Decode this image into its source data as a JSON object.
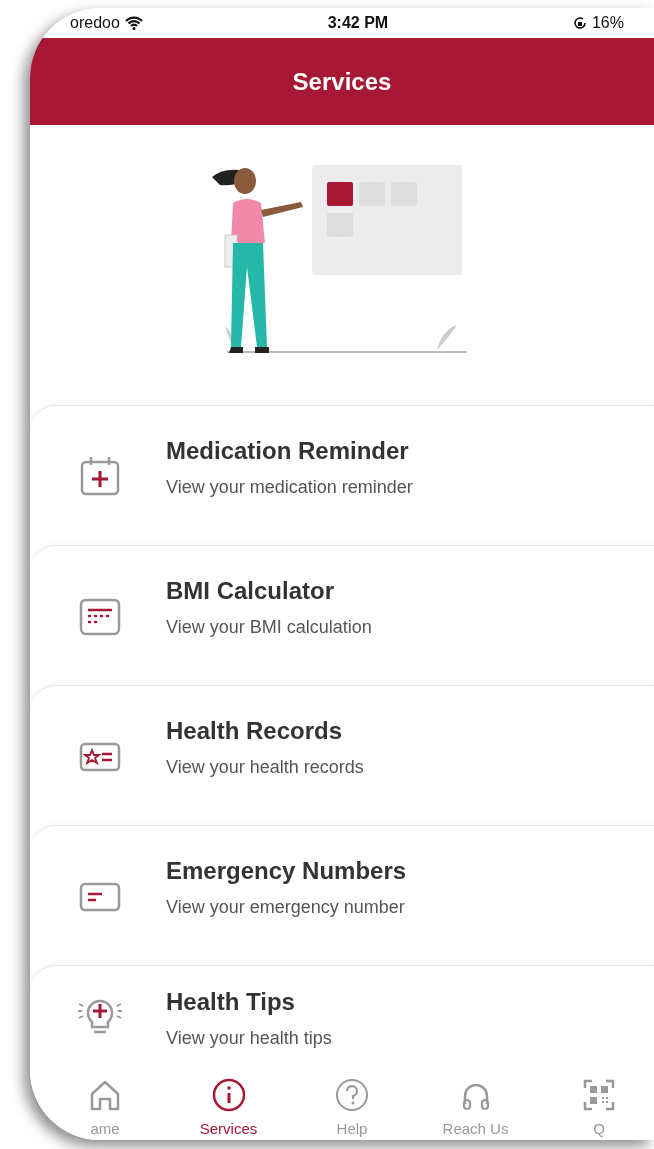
{
  "status_bar": {
    "carrier": "oredoo",
    "time": "3:42 PM",
    "battery": "16%"
  },
  "header": {
    "title": "Services"
  },
  "services": [
    {
      "kind": "calendar",
      "title": "Medication Reminder",
      "subtitle": "View your medication reminder"
    },
    {
      "kind": "calculator",
      "title": "BMI Calculator",
      "subtitle": "View your BMI calculation"
    },
    {
      "kind": "records",
      "title": "Health Records",
      "subtitle": "View your health records"
    },
    {
      "kind": "card",
      "title": "Emergency Numbers",
      "subtitle": "View your emergency number"
    },
    {
      "kind": "bulb",
      "title": "Health Tips",
      "subtitle": "View your health tips"
    }
  ],
  "tab_bar": [
    {
      "kind": "home",
      "label": "ame",
      "selected": false
    },
    {
      "kind": "info",
      "label": "Services",
      "selected": true
    },
    {
      "kind": "help",
      "label": "Help",
      "selected": false
    },
    {
      "kind": "headphones",
      "label": "Reach Us",
      "selected": false
    },
    {
      "kind": "qr",
      "label": "Q",
      "selected": false
    }
  ]
}
